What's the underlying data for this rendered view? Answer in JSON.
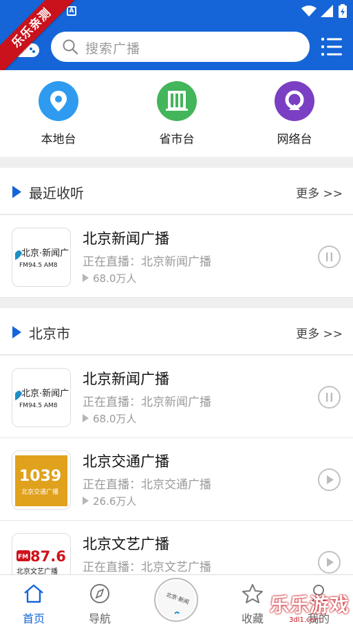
{
  "header": {
    "search_placeholder": "搜索广播",
    "ribbon_text": "乐乐亲测",
    "accent": "#1565d8"
  },
  "categories": [
    {
      "label": "本地台",
      "icon": "location-pin-icon",
      "color": "#2e9bf0"
    },
    {
      "label": "省市台",
      "icon": "building-icon",
      "color": "#43b55a"
    },
    {
      "label": "网络台",
      "icon": "network-radio-icon",
      "color": "#7b3fc3"
    }
  ],
  "recent": {
    "title": "最近收听",
    "more": "更多 >>",
    "items": [
      {
        "name": "北京新闻广播",
        "live": "正在直播：北京新闻广播",
        "listeners": "68.0万人",
        "state": "pause",
        "logo_text": "北京·新闻广",
        "logo_sub": "FM94.5  AM8"
      }
    ]
  },
  "beijing": {
    "title": "北京市",
    "more": "更多 >>",
    "items": [
      {
        "name": "北京新闻广播",
        "live": "正在直播：北京新闻广播",
        "listeners": "68.0万人",
        "state": "pause",
        "logo_text": "北京·新闻广",
        "logo_sub": "FM94.5  AM8"
      },
      {
        "name": "北京交通广播",
        "live": "正在直播：北京交通广播",
        "listeners": "26.6万人",
        "state": "play",
        "logo_text": "1039",
        "logo_sub": "北京交通广播"
      },
      {
        "name": "北京文艺广播",
        "live": "正在直播：北京文艺广播",
        "listeners": "",
        "state": "play",
        "logo_text": "87.6",
        "logo_sub": "北京文艺广播"
      }
    ]
  },
  "bottom_nav": [
    {
      "label": "首页",
      "icon": "home-icon",
      "active": true
    },
    {
      "label": "导航",
      "icon": "compass-icon",
      "active": false
    },
    {
      "label": "",
      "icon": "now-playing-disc",
      "active": false
    },
    {
      "label": "收藏",
      "icon": "star-icon",
      "active": false
    },
    {
      "label": "我的",
      "icon": "user-icon",
      "active": false
    }
  ],
  "watermark": {
    "text": "乐乐游戏",
    "sub": "3dl1.com"
  }
}
